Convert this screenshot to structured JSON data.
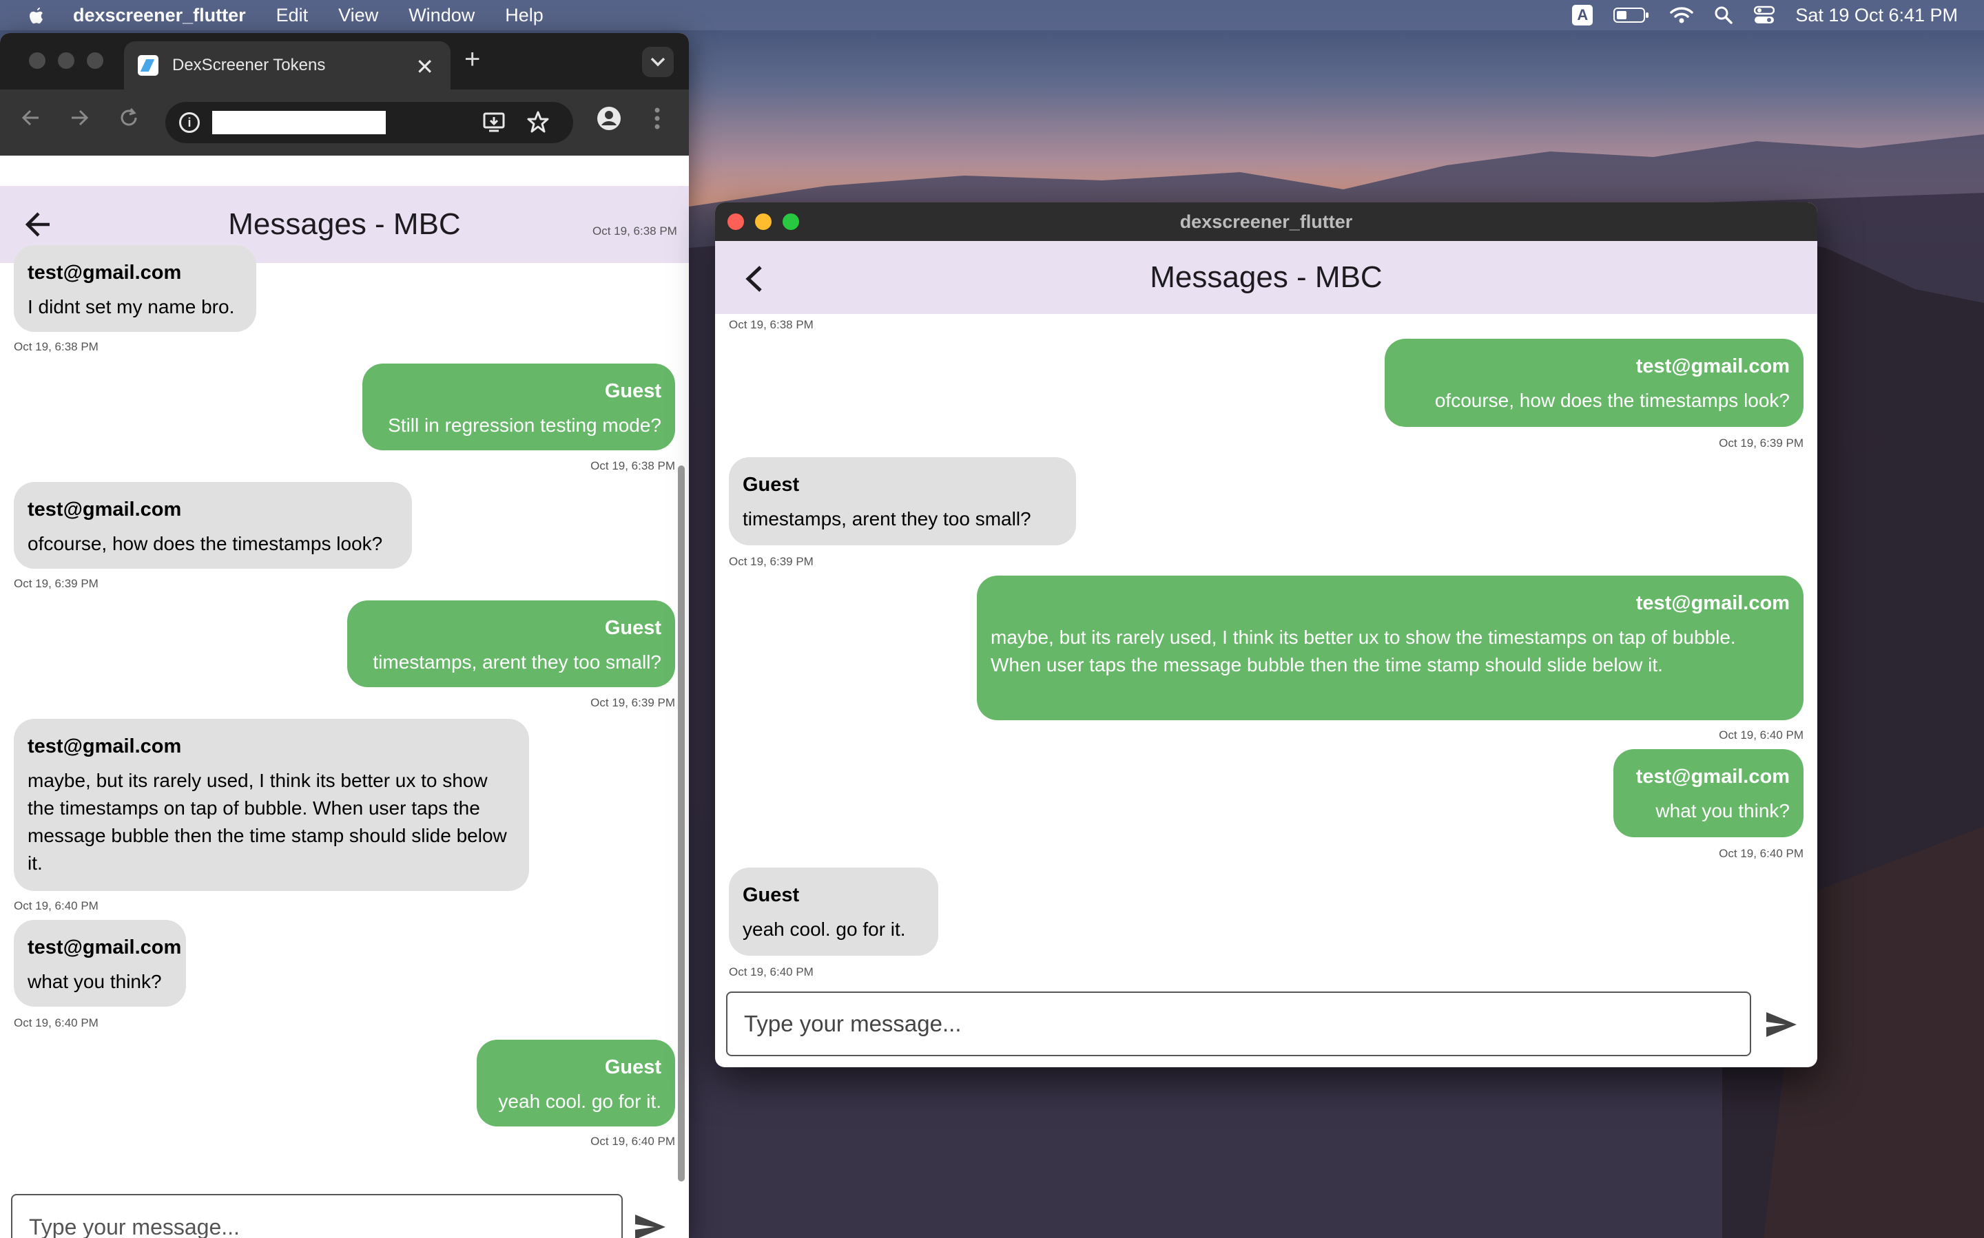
{
  "menubar": {
    "app_name": "dexscreener_flutter",
    "menus": [
      "Edit",
      "View",
      "Window",
      "Help"
    ],
    "input_source": "A",
    "datetime": "Sat 19 Oct  6:41 PM"
  },
  "browser": {
    "tab_title": "DexScreener Tokens",
    "tab_close": "✕",
    "new_tab": "+",
    "page_title": "Messages - MBC",
    "input_placeholder": "Type your message...",
    "top_cut_timestamp": "Oct 19, 6:38 PM",
    "messages": [
      {
        "side": "them",
        "sender": "test@gmail.com",
        "text": "I didnt set my name bro.",
        "time": "Oct 19, 6:38 PM"
      },
      {
        "side": "me",
        "sender": "Guest",
        "text": "Still in regression testing mode?",
        "time": "Oct 19, 6:38 PM"
      },
      {
        "side": "them",
        "sender": "test@gmail.com",
        "text": "ofcourse, how does the timestamps look?",
        "time": "Oct 19, 6:39 PM"
      },
      {
        "side": "me",
        "sender": "Guest",
        "text": "timestamps, arent they too small?",
        "time": "Oct 19, 6:39 PM"
      },
      {
        "side": "them",
        "sender": "test@gmail.com",
        "text": "maybe, but its rarely used, I think its better ux to show the timestamps on tap of bubble. When user taps the message bubble then the time stamp should slide below it.",
        "time": "Oct 19, 6:40 PM"
      },
      {
        "side": "them",
        "sender": "test@gmail.com",
        "text": "what you think?",
        "time": "Oct 19, 6:40 PM"
      },
      {
        "side": "me",
        "sender": "Guest",
        "text": "yeah cool. go for it.",
        "time": "Oct 19, 6:40 PM"
      }
    ]
  },
  "desktop": {
    "window_title": "dexscreener_flutter",
    "page_title": "Messages - MBC",
    "input_placeholder": "Type your message...",
    "top_timestamp": "Oct 19, 6:38 PM",
    "messages": [
      {
        "side": "me",
        "sender": "test@gmail.com",
        "text": "ofcourse, how does the timestamps look?",
        "time": "Oct 19, 6:39 PM"
      },
      {
        "side": "them",
        "sender": "Guest",
        "text": "timestamps, arent they too small?",
        "time": "Oct 19, 6:39 PM"
      },
      {
        "side": "me",
        "sender": "test@gmail.com",
        "text": "maybe, but its rarely used, I think its better ux to show the timestamps on tap of bubble. When user taps the message bubble then the time stamp should slide below it.",
        "time": "Oct 19, 6:40 PM"
      },
      {
        "side": "me",
        "sender": "test@gmail.com",
        "text": "what you think?",
        "time": "Oct 19, 6:40 PM"
      },
      {
        "side": "them",
        "sender": "Guest",
        "text": "yeah cool. go for it.",
        "time": "Oct 19, 6:40 PM"
      }
    ]
  },
  "colors": {
    "sent_bubble": "#66b868",
    "received_bubble": "#e0e0e0",
    "appbar": "#e9e1f2"
  },
  "icons": [
    "apple-icon",
    "battery-icon",
    "wifi-icon",
    "spotlight-icon",
    "control-center-icon",
    "flutter-favicon",
    "back-arrow-icon",
    "forward-arrow-icon",
    "reload-icon",
    "info-icon",
    "install-icon",
    "star-icon",
    "profile-icon",
    "kebab-menu-icon",
    "chevron-left-icon",
    "send-icon"
  ]
}
